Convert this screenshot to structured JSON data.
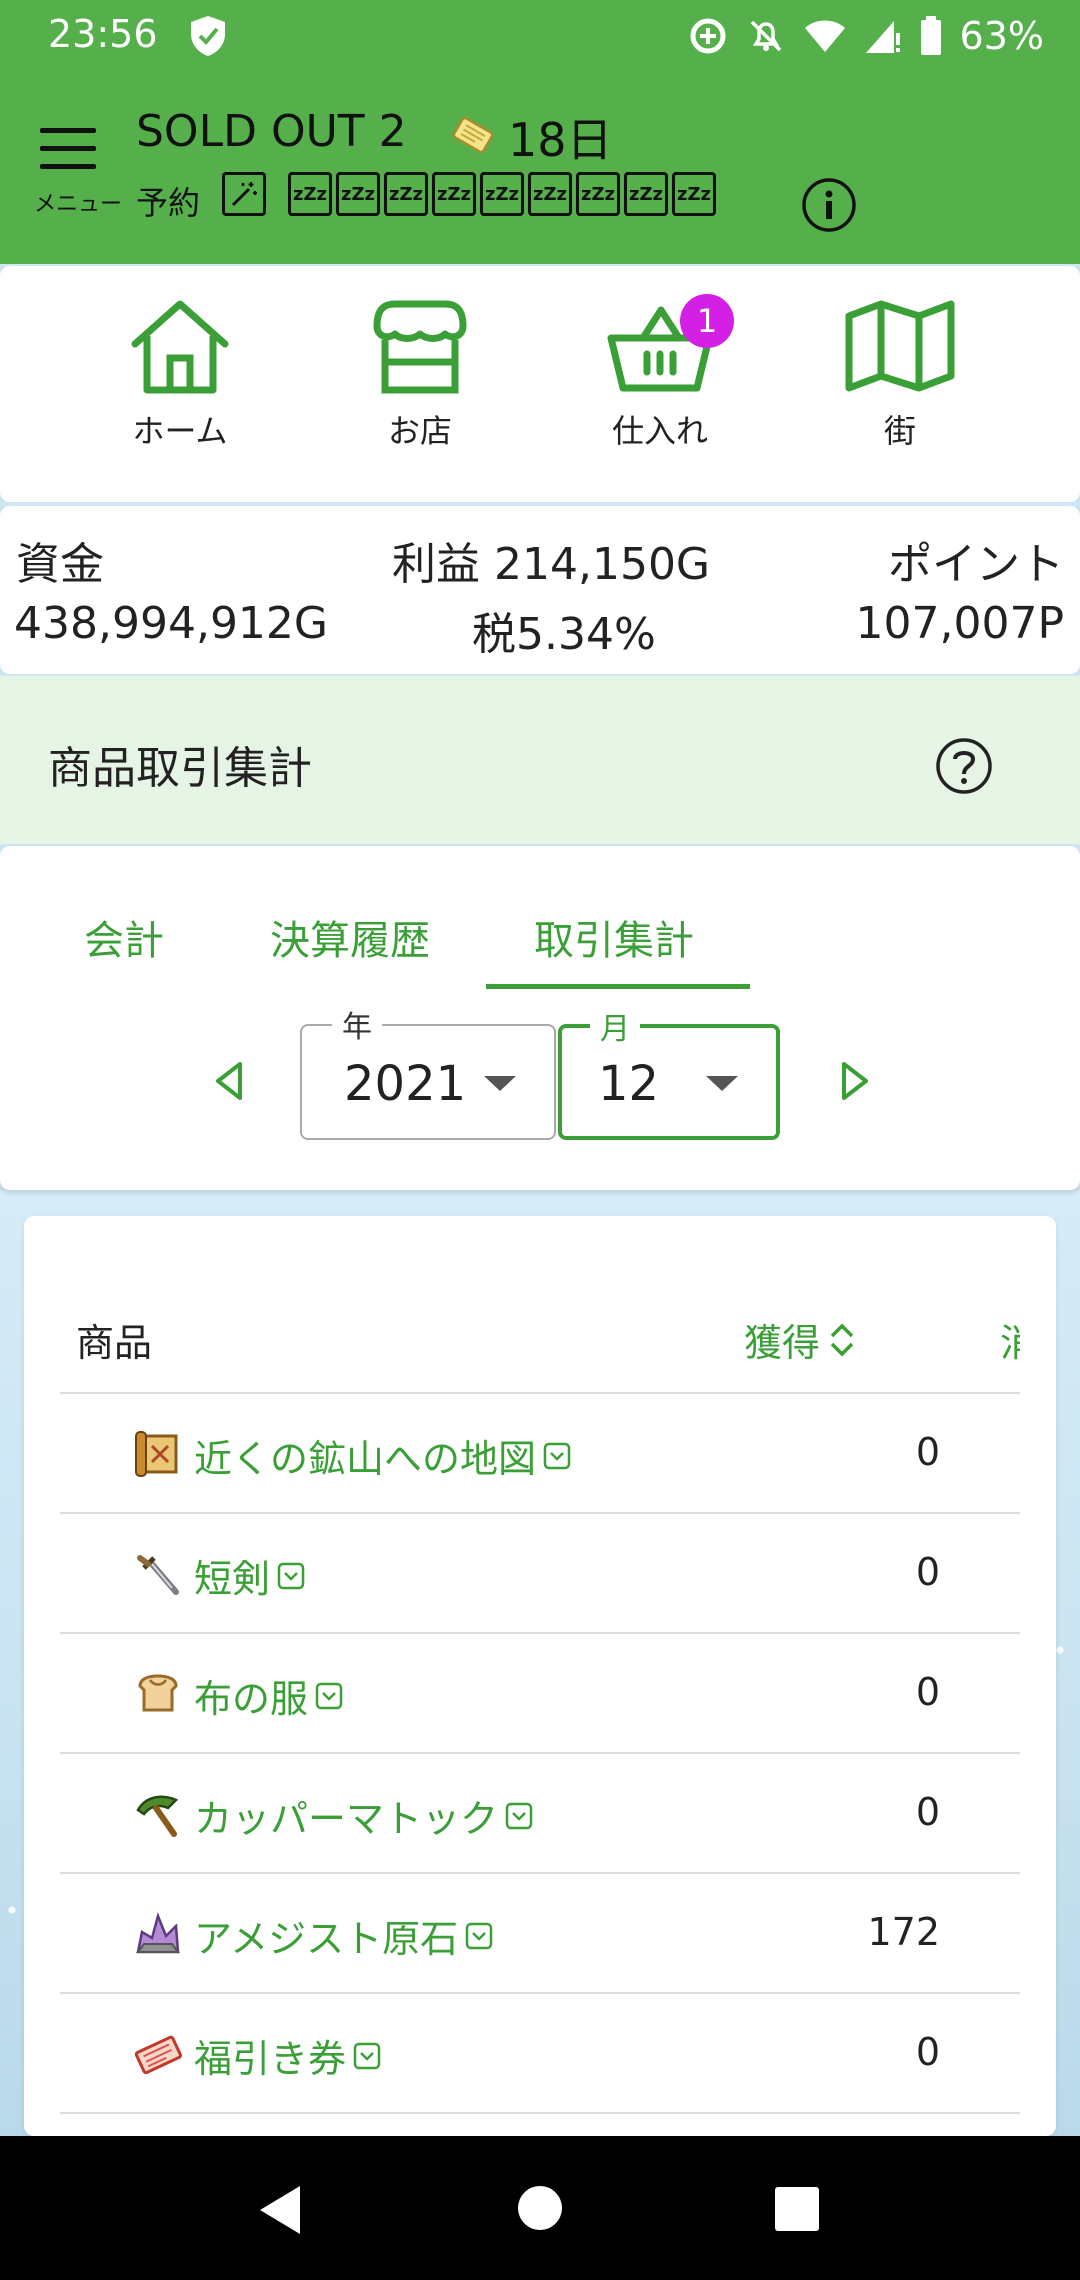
{
  "status_bar": {
    "time": "23:56",
    "battery": "63%"
  },
  "header": {
    "menu_label": "メニュー",
    "title": "SOLD OUT 2",
    "day": "18日",
    "reservation_label": "予約",
    "zz_label": "zZz"
  },
  "nav": [
    {
      "label": "ホーム"
    },
    {
      "label": "お店"
    },
    {
      "label": "仕入れ",
      "badge": "1"
    },
    {
      "label": "街"
    }
  ],
  "stats": {
    "funds_label": "資金",
    "funds_value": "438,994,912G",
    "profit": "利益 214,150G",
    "tax": "税5.34%",
    "points_label": "ポイント",
    "points_value": "107,007P"
  },
  "section": {
    "title": "商品取引集計"
  },
  "tabs": [
    {
      "label": "会計"
    },
    {
      "label": "決算履歴"
    },
    {
      "label": "取引集計",
      "active": true
    }
  ],
  "filters": {
    "year_label": "年",
    "year_value": "2021",
    "month_label": "月",
    "month_value": "12"
  },
  "table": {
    "col_item": "商品",
    "col_acquired": "獲得",
    "col_next": "消",
    "rows": [
      {
        "name": "近くの鉱山への地図",
        "icon": "map-scroll-icon",
        "value": "0"
      },
      {
        "name": "短剣",
        "icon": "dagger-icon",
        "value": "0"
      },
      {
        "name": "布の服",
        "icon": "cloth-icon",
        "value": "0"
      },
      {
        "name": "カッパーマトック",
        "icon": "mattock-icon",
        "value": "0"
      },
      {
        "name": "アメジスト原石",
        "icon": "amethyst-icon",
        "value": "172"
      },
      {
        "name": "福引き券",
        "icon": "lottery-ticket-icon",
        "value": "0"
      }
    ]
  },
  "colors": {
    "primary": "#55b04c",
    "accent_text": "#3a9f36",
    "badge": "#d41fe4"
  }
}
